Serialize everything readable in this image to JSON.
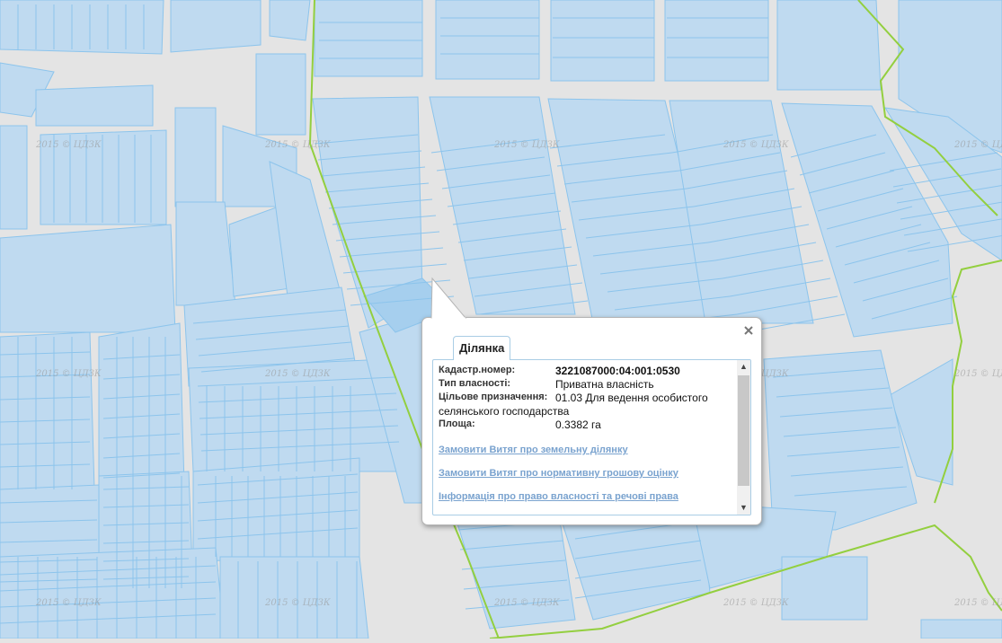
{
  "map": {
    "watermark": "2015 © ЦДЗК",
    "colors": {
      "background": "#e4e4e4",
      "parcel_fill": "#bfdaf0",
      "parcel_highlight": "#a6cfee",
      "parcel_stroke": "#8cc4ec",
      "boundary_line": "#93cf3f"
    }
  },
  "popup": {
    "tab_title": "Ділянка",
    "close_icon": "close-icon",
    "fields": [
      {
        "label": "Кадастр.номер:",
        "value": "3221087000:04:001:0530"
      },
      {
        "label": "Тип власності:",
        "value": "Приватна власність"
      },
      {
        "label": "Цільове призначення:",
        "value": "01.03 Для ведення особистого селянського господарства"
      },
      {
        "label": "Площа:",
        "value": "0.3382 га"
      }
    ],
    "links": [
      "Замовити Витяг про земельну ділянку",
      "Замовити Витяг про нормативну грошову оцінку",
      "Інформація про право власності та речові права"
    ]
  }
}
